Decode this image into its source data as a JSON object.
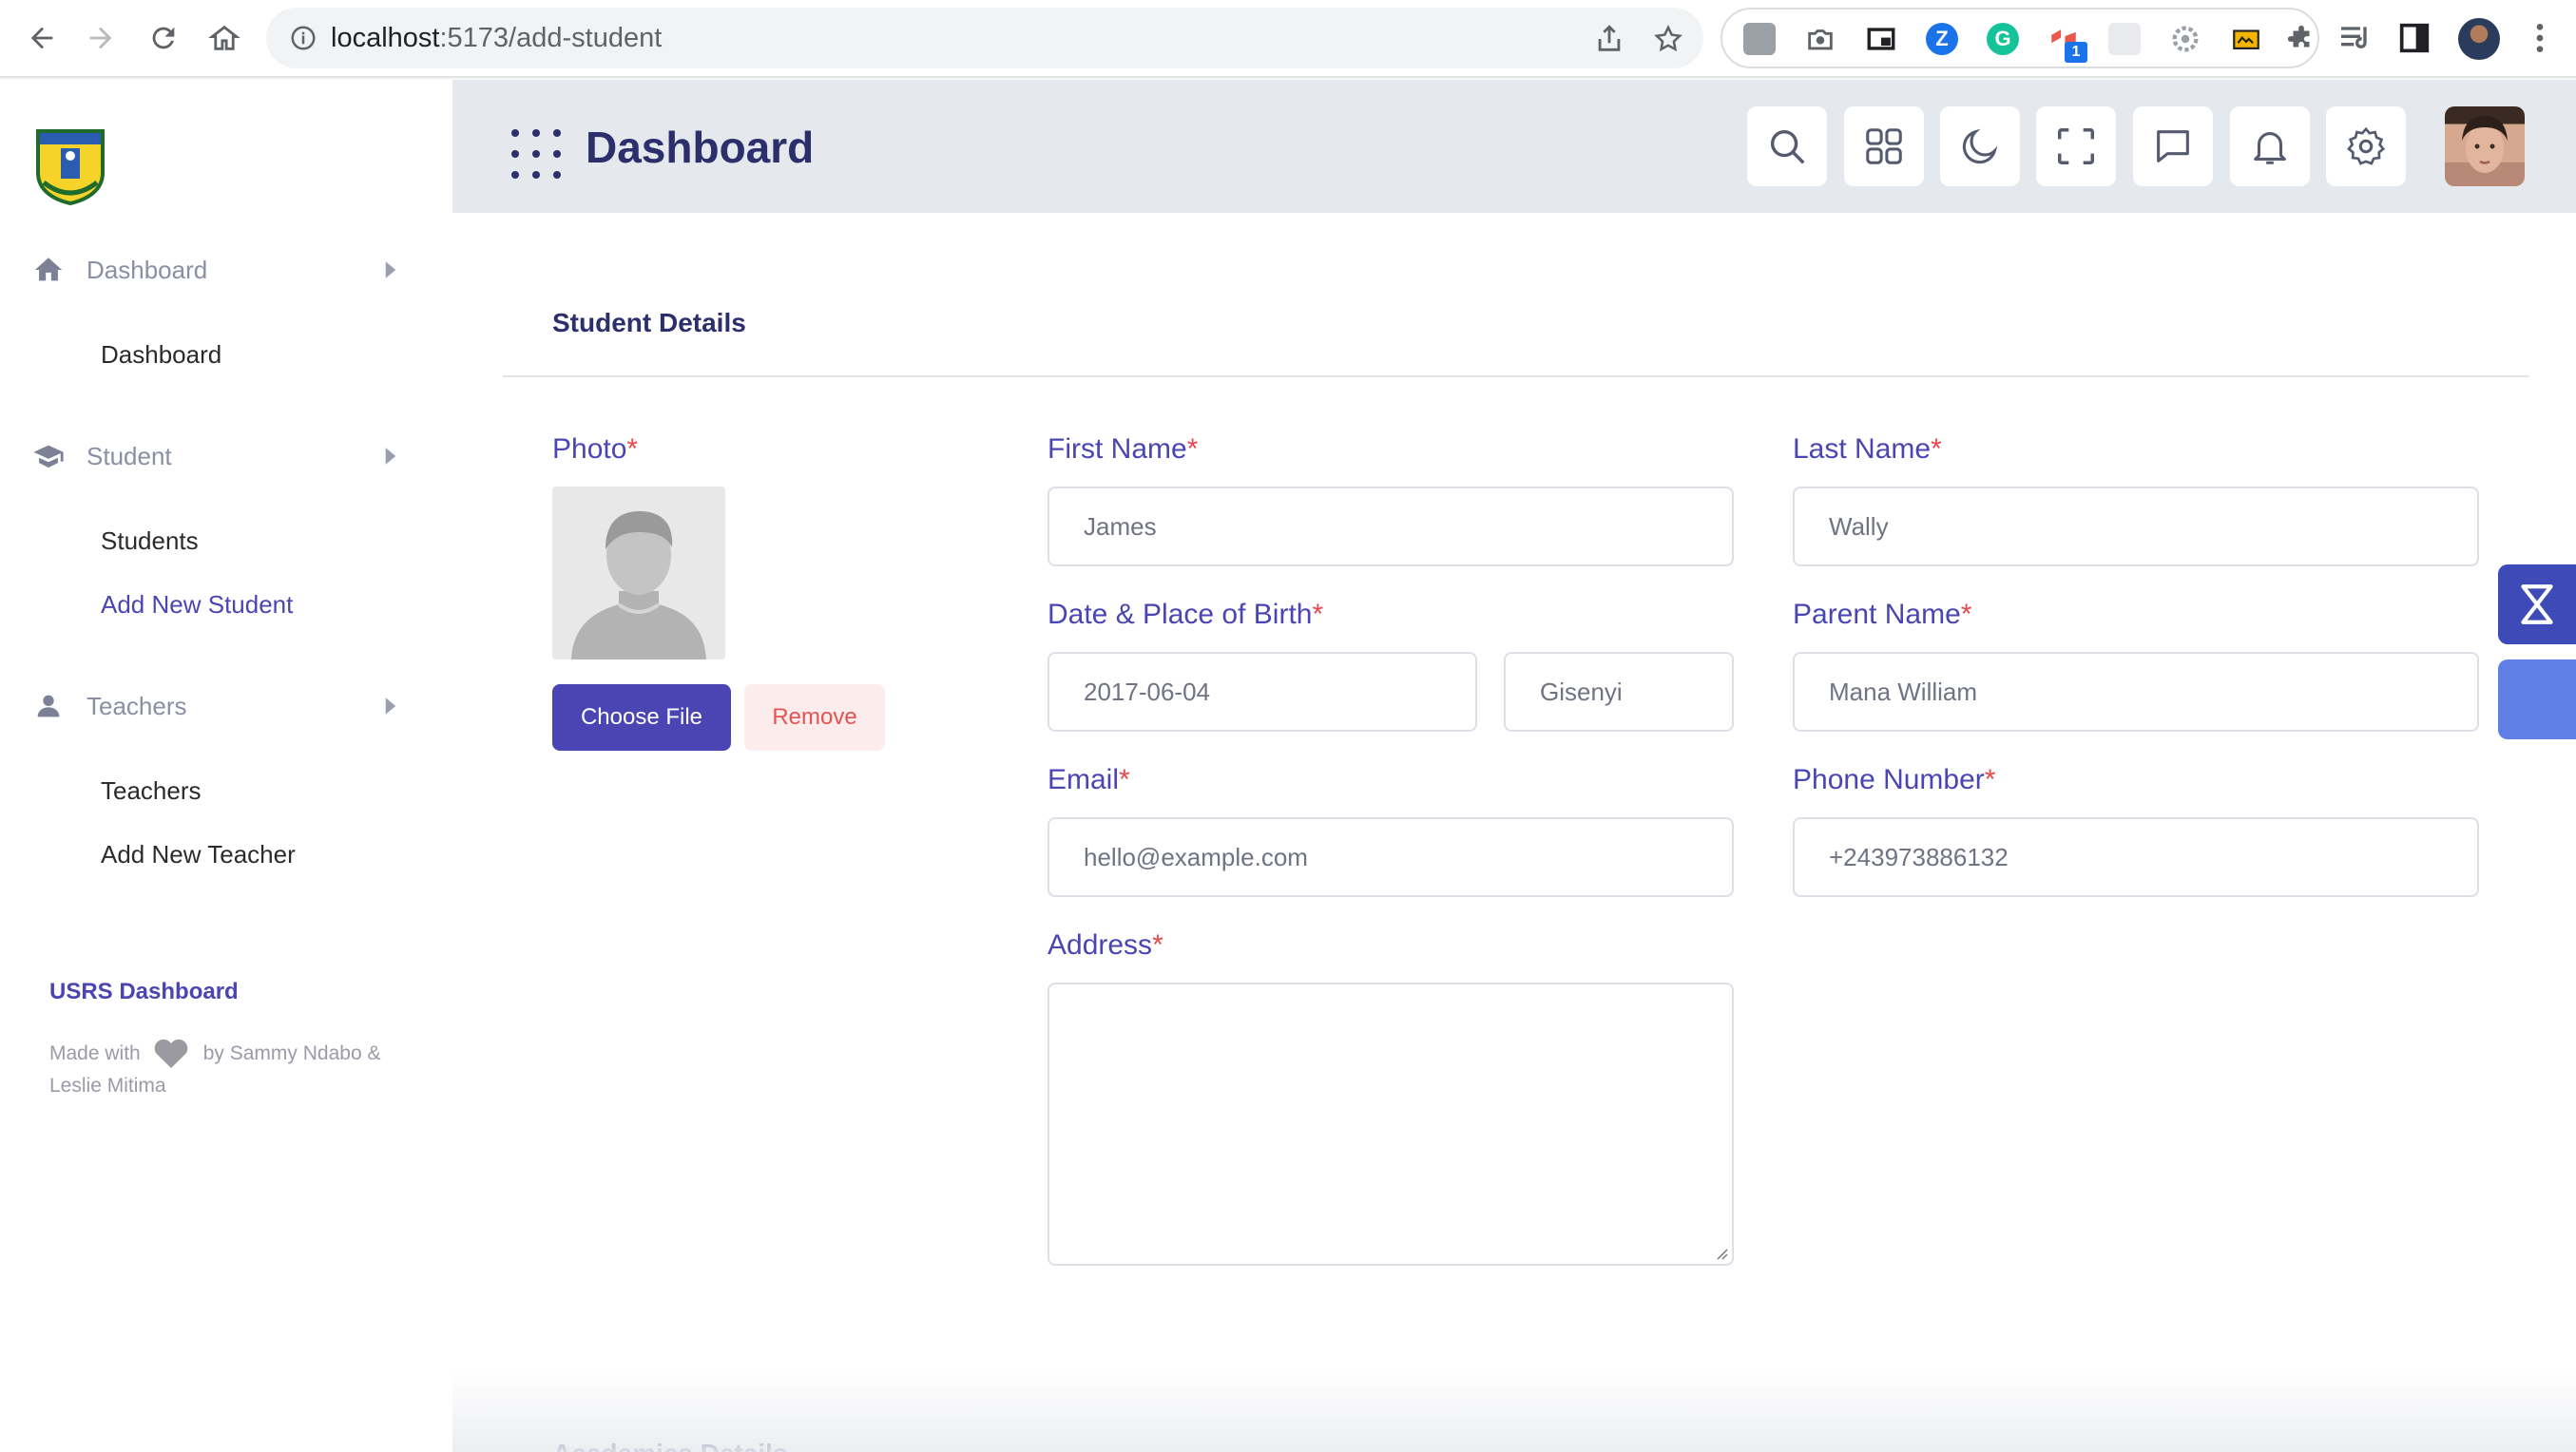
{
  "browser": {
    "url_host": "localhost",
    "url_path": ":5173/add-student",
    "extension_badge": "1"
  },
  "sidebar": {
    "sections": [
      {
        "label": "Dashboard",
        "icon": "home-icon",
        "items": [
          "Dashboard"
        ]
      },
      {
        "label": "Student",
        "icon": "graduation-cap-icon",
        "items": [
          "Students",
          "Add New Student"
        ]
      },
      {
        "label": "Teachers",
        "icon": "person-icon",
        "items": [
          "Teachers",
          "Add New Teacher"
        ]
      }
    ],
    "active_item": "Add New Student",
    "brand": "USRS Dashboard",
    "made_with_prefix": "Made with",
    "made_with_suffix": "by Sammy Ndabo & Leslie Mitima"
  },
  "header": {
    "title": "Dashboard",
    "buttons": [
      "search-icon",
      "apps-grid-icon",
      "moon-icon",
      "fullscreen-icon",
      "chat-icon",
      "bell-icon",
      "gear-icon"
    ]
  },
  "form": {
    "section_title": "Student Details",
    "required_mark": "*",
    "photo_label": "Photo",
    "choose_file": "Choose File",
    "remove": "Remove",
    "first_name": {
      "label": "First Name",
      "value": "James"
    },
    "last_name": {
      "label": "Last Name",
      "value": "Wally"
    },
    "birth": {
      "label": "Date & Place of Birth",
      "date": "2017-06-04",
      "place": "Gisenyi"
    },
    "parent_name": {
      "label": "Parent Name",
      "value": "Mana William"
    },
    "email": {
      "label": "Email",
      "placeholder": "hello@example.com"
    },
    "phone": {
      "label": "Phone Number",
      "placeholder": "+243973886132"
    },
    "address": {
      "label": "Address",
      "value": ""
    },
    "next_section_title": "Academics Details"
  },
  "colors": {
    "accent": "#4a45b3",
    "required": "#e5484d",
    "title": "#2b2f6b",
    "remove_bg": "#fdecec"
  }
}
